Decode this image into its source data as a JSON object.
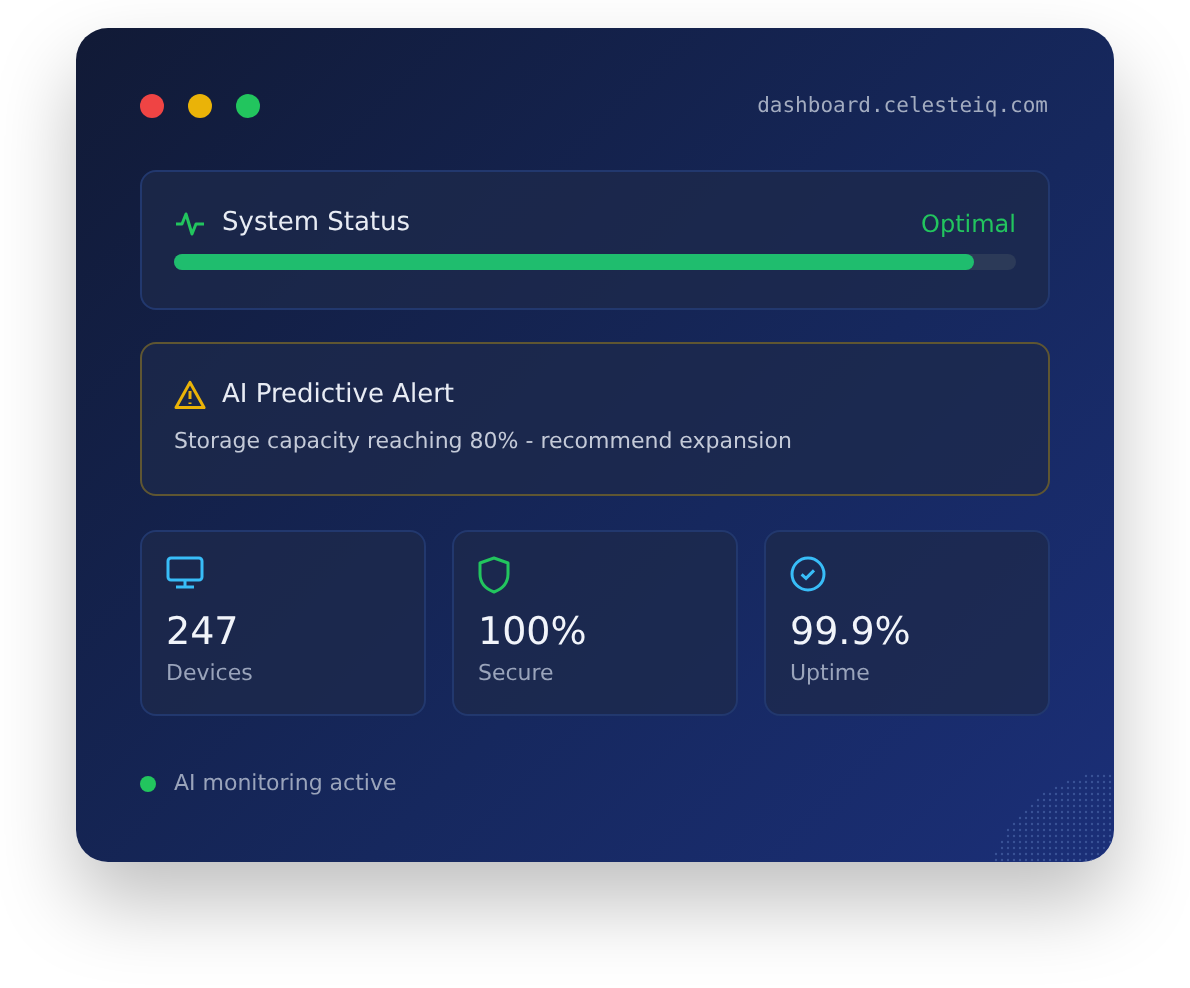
{
  "window": {
    "address": "dashboard.celesteiq.com",
    "controls": [
      {
        "color": "#ef4444"
      },
      {
        "color": "#eab308"
      },
      {
        "color": "#22c55e"
      }
    ]
  },
  "system_status": {
    "title": "System Status",
    "state": "Optimal",
    "level": 0.95
  },
  "alert": {
    "title": "AI Predictive Alert",
    "message": "Storage capacity reaching 80% - recommend expansion"
  },
  "stats": [
    {
      "kind": "monitor",
      "value": "247",
      "label": "Devices"
    },
    {
      "kind": "shield",
      "value": "100%",
      "label": "Secure"
    },
    {
      "kind": "check",
      "value": "99.9%",
      "label": "Uptime"
    }
  ],
  "footer": {
    "text": "AI monitoring active",
    "active": true
  }
}
